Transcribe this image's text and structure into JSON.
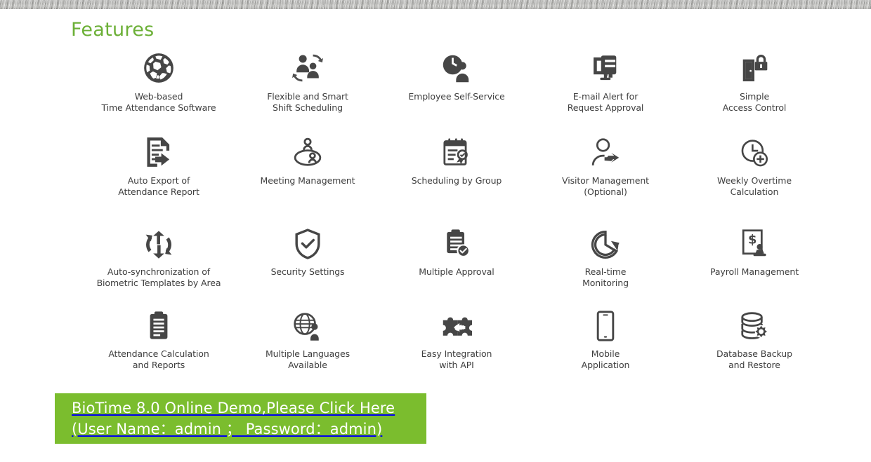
{
  "header": {
    "heading": "Features",
    "heading_color": "#6cb037"
  },
  "decor": {
    "top_strip": "brushed-metal-strip"
  },
  "features": [
    {
      "icon": "globe-web-icon",
      "label": "Web-based\nTime Attendance Software"
    },
    {
      "icon": "people-shift-icon",
      "label": "Flexible and Smart\nShift Scheduling"
    },
    {
      "icon": "clock-person-icon",
      "label": "Employee Self-Service"
    },
    {
      "icon": "monitor-message-icon",
      "label": "E-mail Alert for\nRequest Approval"
    },
    {
      "icon": "door-lock-icon",
      "label": "Simple\nAccess Control"
    },
    {
      "icon": "document-export-icon",
      "label": "Auto Export of\nAttendance Report"
    },
    {
      "icon": "meeting-table-icon",
      "label": "Meeting Management"
    },
    {
      "icon": "calendar-search-icon",
      "label": "Scheduling by Group"
    },
    {
      "icon": "person-arrow-icon",
      "label": "Visitor Management\n(Optional)"
    },
    {
      "icon": "clock-plus-icon",
      "label": "Weekly Overtime\nCalculation"
    },
    {
      "icon": "sync-arrows-icon",
      "label": "Auto-synchronization of\nBiometric Templates by Area"
    },
    {
      "icon": "shield-check-icon",
      "label": "Security Settings"
    },
    {
      "icon": "clipboard-check-icon",
      "label": "Multiple Approval"
    },
    {
      "icon": "clock-arrow-icon",
      "label": "Real-time\nMonitoring"
    },
    {
      "icon": "payroll-stamp-icon",
      "label": "Payroll Management"
    },
    {
      "icon": "clipboard-lines-icon",
      "label": "Attendance Calculation\nand Reports"
    },
    {
      "icon": "globe-person-icon",
      "label": "Multiple Languages\nAvailable"
    },
    {
      "icon": "puzzle-api-icon",
      "label": "Easy Integration\nwith API"
    },
    {
      "icon": "mobile-phone-icon",
      "label": "Mobile\nApplication"
    },
    {
      "icon": "database-gear-icon",
      "label": "Database Backup\nand Restore"
    }
  ],
  "cta": {
    "line1": "BioTime 8.0 Online Demo,Please Click Here",
    "line2": "(User Name：admin ； Password：admin)",
    "background_color": "#7bbd2e",
    "text_color": "#ffffff"
  }
}
